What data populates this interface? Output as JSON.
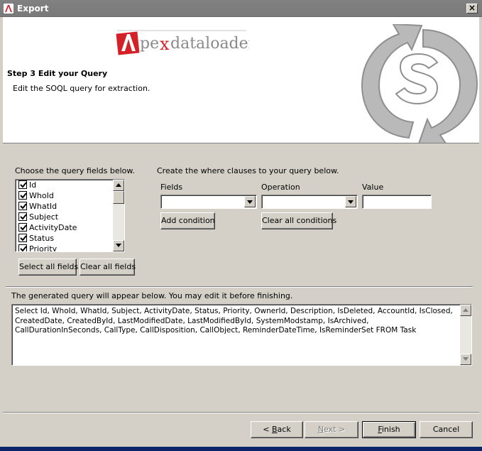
{
  "window": {
    "title": "Export",
    "close_label": "×"
  },
  "header": {
    "logo_text": "Apexdataloader",
    "step_title": "Step 3  Edit your Query",
    "step_description": "Edit the SOQL query for extraction."
  },
  "fields_panel": {
    "label": "Choose the query fields below.",
    "items": [
      {
        "label": "Id",
        "checked": true
      },
      {
        "label": "WhoId",
        "checked": true
      },
      {
        "label": "WhatId",
        "checked": true
      },
      {
        "label": "Subject",
        "checked": true
      },
      {
        "label": "ActivityDate",
        "checked": true
      },
      {
        "label": "Status",
        "checked": true
      },
      {
        "label": "Priority",
        "checked": true
      }
    ],
    "select_all_label": "Select all fields",
    "clear_all_label": "Clear all fields"
  },
  "where_panel": {
    "label": "Create the where clauses to your query below.",
    "fields_label": "Fields",
    "operation_label": "Operation",
    "value_label": "Value",
    "fields_value": "",
    "operation_value": "",
    "value_value": "",
    "add_condition_label": "Add condition",
    "clear_conditions_label": "Clear all conditions"
  },
  "query_panel": {
    "label": "The generated query will appear below.  You may edit it before finishing.",
    "query": "Select Id, WhoId, WhatId, Subject, ActivityDate, Status, Priority, OwnerId, Description, IsDeleted, AccountId, IsClosed, CreatedDate, CreatedById, LastModifiedDate, LastModifiedById, SystemModstamp, IsArchived, CallDurationInSeconds, CallType, CallDisposition, CallObject, ReminderDateTime, IsReminderSet FROM Task"
  },
  "footer": {
    "back_prefix": "< ",
    "back_mnemonic": "B",
    "back_rest": "ack",
    "next_mnemonic": "N",
    "next_rest": "ext >",
    "finish_mnemonic": "F",
    "finish_rest": "inish",
    "cancel_label": "Cancel"
  },
  "colors": {
    "titlebar": "#808080",
    "dialog_bg": "#d4d0c8",
    "logo_red": "#d42027",
    "logo_gray": "#8a8a8a"
  }
}
